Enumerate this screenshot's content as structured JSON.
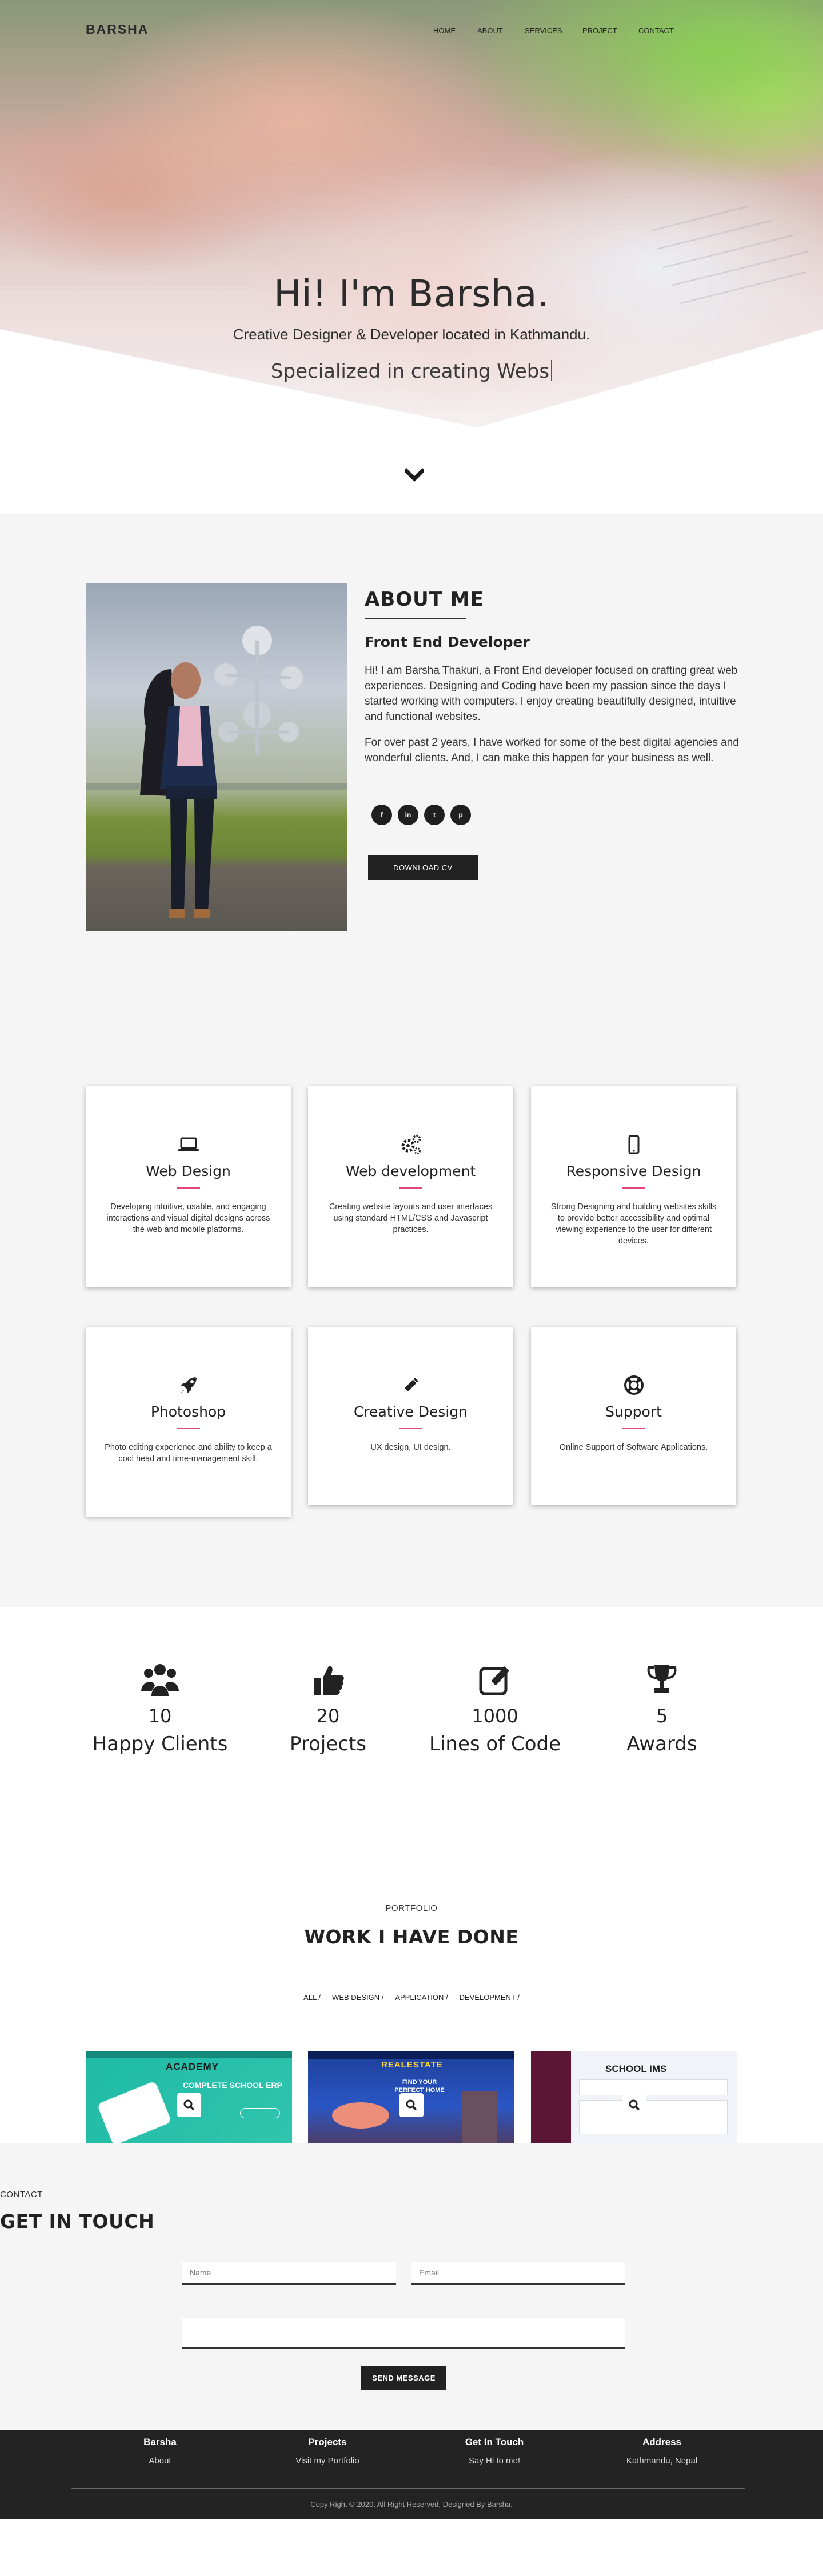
{
  "nav": {
    "brand": "BARSHA",
    "items": [
      "HOME",
      "ABOUT",
      "SERVICES",
      "PROJECT",
      "CONTACT"
    ]
  },
  "hero": {
    "title": "Hi! I'm Barsha.",
    "subtitle": "Creative Designer & Developer located in Kathmandu.",
    "typed": "Specialized in creating Webs"
  },
  "about": {
    "heading": "ABOUT ME",
    "role": "Front End Developer",
    "p1": "Hi! I am Barsha Thakuri, a Front End developer focused on crafting great web experiences. Designing and Coding have been my passion since the days I started working with computers. I enjoy creating beautifully designed, intuitive and functional websites.",
    "p2": "For over past 2 years, I have worked for some of the best digital agencies and wonderful clients. And, I can make this happen for your business as well.",
    "socials": [
      "f",
      "in",
      "t",
      "p"
    ],
    "cv_label": "DOWNLOAD CV"
  },
  "services": [
    {
      "icon": "laptop-icon",
      "title": "Web Design",
      "desc": "Developing intuitive, usable, and engaging interactions and visual digital designs across the web and mobile platforms."
    },
    {
      "icon": "gears-icon",
      "title": "Web development",
      "desc": "Creating website layouts and user interfaces using standard HTML/CSS and Javascript practices."
    },
    {
      "icon": "mobile-icon",
      "title": "Responsive Design",
      "desc": "Strong Designing and building websites skills to provide better accessibility and optimal viewing experience to the user for different devices."
    },
    {
      "icon": "rocket-icon",
      "title": "Photoshop",
      "desc": "Photo editing experience and ability to keep a cool head and time-management skill."
    },
    {
      "icon": "pencil-icon",
      "title": "Creative Design",
      "desc": "UX design, UI design."
    },
    {
      "icon": "lifering-icon",
      "title": "Support",
      "desc": "Online Support of Software Applications."
    }
  ],
  "stats": [
    {
      "icon": "users-icon",
      "value": "10",
      "label": "Happy Clients"
    },
    {
      "icon": "thumbs-up-icon",
      "value": "20",
      "label": "Projects"
    },
    {
      "icon": "edit-icon",
      "value": "1000",
      "label": "Lines of Code"
    },
    {
      "icon": "trophy-icon",
      "value": "5",
      "label": "Awards"
    }
  ],
  "portfolio": {
    "kicker": "PORTFOLIO",
    "title": "WORK I HAVE DONE",
    "filters": [
      "ALL /",
      "WEB DESIGN /",
      "APPLICATION /",
      "DEVELOPMENT /"
    ],
    "thumbs": [
      {
        "heading": "ACADEMY",
        "line": "COMPLETE SCHOOL ERP"
      },
      {
        "heading": "REALESTATE",
        "line": "FIND YOUR PERFECT HOME"
      },
      {
        "heading": "SCHOOL IMS",
        "line": ""
      }
    ]
  },
  "contact": {
    "kicker": "CONTACT",
    "title": "GET IN TOUCH",
    "name_placeholder": "Name",
    "email_placeholder": "Email",
    "send_label": "SEND MESSAGE"
  },
  "footer": {
    "cols": [
      {
        "heading": "Barsha",
        "link": "About"
      },
      {
        "heading": "Projects",
        "link": "Visit my Portfolio"
      },
      {
        "heading": "Get In Touch",
        "link": "Say Hi to me!"
      },
      {
        "heading": "Address",
        "link": "Kathmandu, Nepal"
      }
    ],
    "copyright": "Copy Right © 2020, All Right Reserved, Designed By Barsha."
  },
  "colors": {
    "accent": "#e0457b",
    "dark": "#222222",
    "section_bg": "#f5f5f5"
  }
}
